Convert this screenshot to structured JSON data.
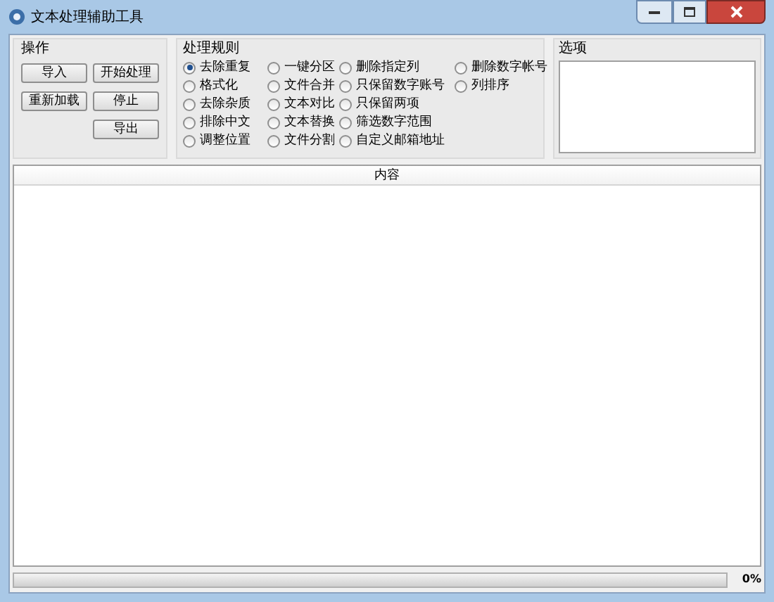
{
  "window": {
    "title": "文本处理辅助工具"
  },
  "operations": {
    "title": "操作",
    "buttons": [
      "导入",
      "开始处理",
      "重新加载",
      "停止",
      "导出"
    ]
  },
  "rules": {
    "title": "处理规则",
    "options": [
      {
        "label": "去除重复",
        "selected": true
      },
      {
        "label": "格式化",
        "selected": false
      },
      {
        "label": "去除杂质",
        "selected": false
      },
      {
        "label": "排除中文",
        "selected": false
      },
      {
        "label": "调整位置",
        "selected": false
      },
      {
        "label": "一键分区",
        "selected": false
      },
      {
        "label": "文件合并",
        "selected": false
      },
      {
        "label": "文本对比",
        "selected": false
      },
      {
        "label": "文本替换",
        "selected": false
      },
      {
        "label": "文件分割",
        "selected": false
      },
      {
        "label": "删除指定列",
        "selected": false
      },
      {
        "label": "只保留数字账号",
        "selected": false
      },
      {
        "label": "只保留两项",
        "selected": false
      },
      {
        "label": "筛选数字范围",
        "selected": false
      },
      {
        "label": "自定义邮箱地址",
        "selected": false
      },
      {
        "label": "删除数字帐号",
        "selected": false
      },
      {
        "label": "列排序",
        "selected": false
      }
    ]
  },
  "options_panel": {
    "title": "选项"
  },
  "content": {
    "header": "内容"
  },
  "progress": {
    "level": 0,
    "reading": "0%"
  }
}
